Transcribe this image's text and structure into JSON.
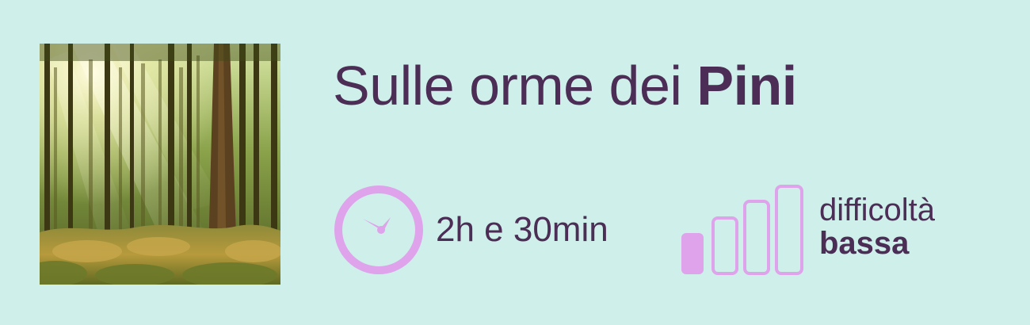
{
  "trail": {
    "title_regular": "Sulle orme dei ",
    "title_bold": "Pini",
    "duration": "2h e 30min",
    "difficulty_label": "difficoltà",
    "difficulty_value": "bassa",
    "difficulty_level": 1,
    "difficulty_max": 4
  },
  "icons": {
    "photo": "pine-forest-photo",
    "duration": "clock-icon",
    "difficulty": "difficulty-bars-icon"
  },
  "colors": {
    "background": "#cfefea",
    "text": "#4b2d55",
    "accent": "#dea3ea"
  }
}
